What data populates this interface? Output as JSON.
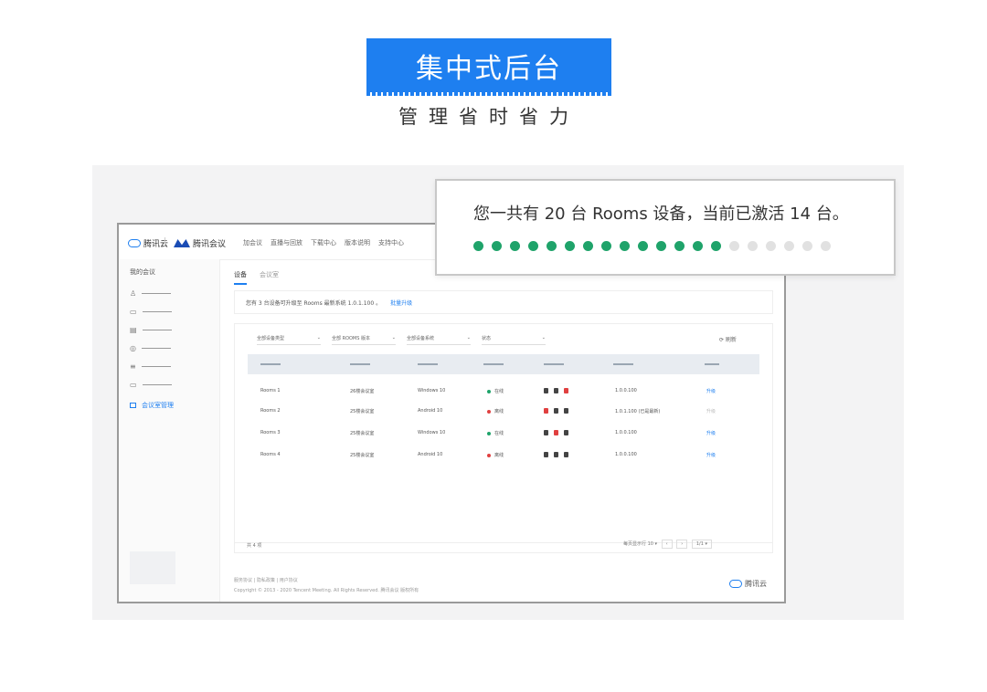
{
  "banner": {
    "title": "集中式后台",
    "subtitle": "管理省时省力"
  },
  "window": {
    "logos": {
      "brand1": "腾讯云",
      "brand2": "腾讯会议"
    },
    "nav": [
      "加会议",
      "直播与回放",
      "下载中心",
      "版本说明",
      "支持中心"
    ],
    "sidebar": {
      "title": "我的会议",
      "icons": [
        "user",
        "calendar",
        "doc",
        "settings",
        "list",
        "card"
      ],
      "active_label": "会议室管理"
    },
    "tabs": [
      "设备",
      "会议室"
    ],
    "notice": {
      "text": "您有 3 台设备可升级至 Rooms 最新系统 1.0.1.100 。",
      "link": "批量升级"
    },
    "filters": [
      {
        "label": "全部设备类型",
        "caret": "⌄"
      },
      {
        "label": "全部 ROOMS 版本",
        "caret": "⌄"
      },
      {
        "label": "全部设备系统",
        "caret": "⌄"
      },
      {
        "label": "状态",
        "caret": "⌄"
      }
    ],
    "refresh": "⟳ 刷新",
    "rows": [
      {
        "name": "Rooms 1",
        "room": "26楼会议室",
        "os": "Windows 10",
        "status": "在线",
        "status_color": "#1fa36a",
        "version": "1.0.0.100",
        "action": "升级",
        "action_disabled": false,
        "icons": [
          "bulb",
          "speaker",
          "mic-red"
        ]
      },
      {
        "name": "Rooms 2",
        "room": "25楼会议室",
        "os": "Android 10",
        "status": "离线",
        "status_color": "#e04040",
        "version": "1.0.1.100 (已是最新)",
        "action": "升级",
        "action_disabled": true,
        "icons": [
          "cam-red",
          "speaker",
          "mic"
        ]
      },
      {
        "name": "Rooms 3",
        "room": "25楼会议室",
        "os": "Windows 10",
        "status": "在线",
        "status_color": "#1fa36a",
        "version": "1.0.0.100",
        "action": "升级",
        "action_disabled": false,
        "icons": [
          "bulb",
          "cam-red",
          "mic"
        ]
      },
      {
        "name": "Rooms 4",
        "room": "25楼会议室",
        "os": "Android 10",
        "status": "离线",
        "status_color": "#e04040",
        "version": "1.0.0.100",
        "action": "升级",
        "action_disabled": false,
        "icons": [
          "bulb",
          "speaker",
          "mic"
        ]
      }
    ],
    "pager": {
      "total": "共 4 项",
      "per_page": "每页显示行 10 ▾",
      "prev": "‹",
      "next": "›",
      "page": "1/1 ▾"
    },
    "footer": {
      "links": "服务协议 | 隐私政策 | 用户协议",
      "copyright": "Copyright © 2013 - 2020 Tencent Meeting. All Rights Reserved. 腾讯会议 版权所有",
      "brand": "腾讯云"
    }
  },
  "callout": {
    "text": "您一共有 20 台 Rooms 设备，当前已激活 14 台。",
    "total": 20,
    "active": 14,
    "colors": {
      "active": "#1fa36a",
      "inactive": "#e1e1e1"
    }
  },
  "colors": {
    "accent": "#1e7ff0",
    "banner": "#1e7ff0"
  }
}
